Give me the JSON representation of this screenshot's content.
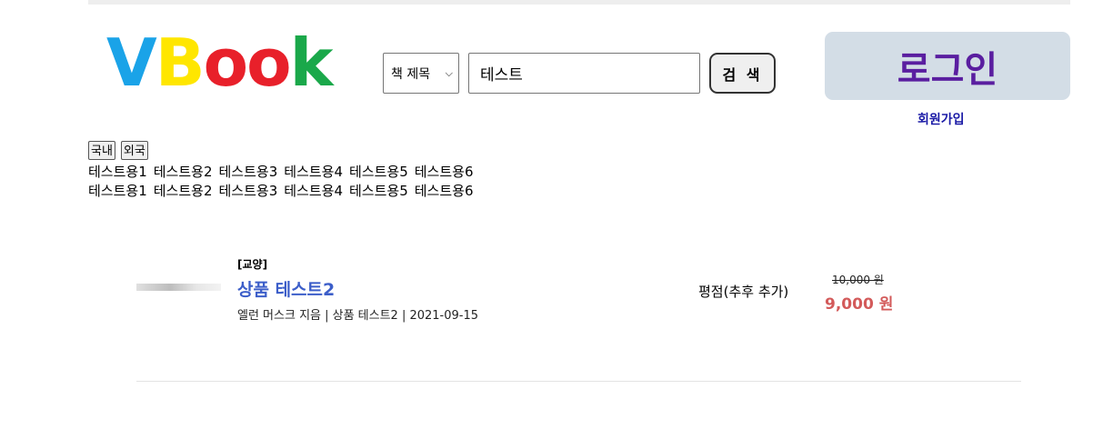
{
  "logo": {
    "letters": [
      "V",
      "B",
      "o",
      "o",
      "k"
    ],
    "colors": [
      "#1aa3e8",
      "#ffe600",
      "#e8202a",
      "#e8202a",
      "#1aa84a"
    ]
  },
  "search": {
    "select_label": "책 제목",
    "input_value": "테스트",
    "button_label": "검 색"
  },
  "auth": {
    "login_label": "로그인",
    "signup_label": "회원가입"
  },
  "categories": {
    "buttons": [
      "국내",
      "외국"
    ],
    "rows": [
      [
        "테스트용1",
        "테스트용2",
        "테스트용3",
        "테스트용4",
        "테스트용5",
        "테스트용6"
      ],
      [
        "테스트용1",
        "테스트용2",
        "테스트용3",
        "테스트용4",
        "테스트용5",
        "테스트용6"
      ]
    ]
  },
  "product": {
    "category": "[교양]",
    "title": "상품 테스트2",
    "meta": "엘런 머스크 지음 | 상품 테스트2 | 2021-09-15",
    "rating": "평점(추후 추가)",
    "original_price": "10,000 원",
    "sale_price": "9,000 원"
  },
  "colors": {
    "title_blue": "#3c5ec9",
    "price_red": "#d35a5a",
    "login_bg": "#d3dde6",
    "login_text": "#5a1ea0",
    "signup_blue": "#1a1aa6"
  }
}
